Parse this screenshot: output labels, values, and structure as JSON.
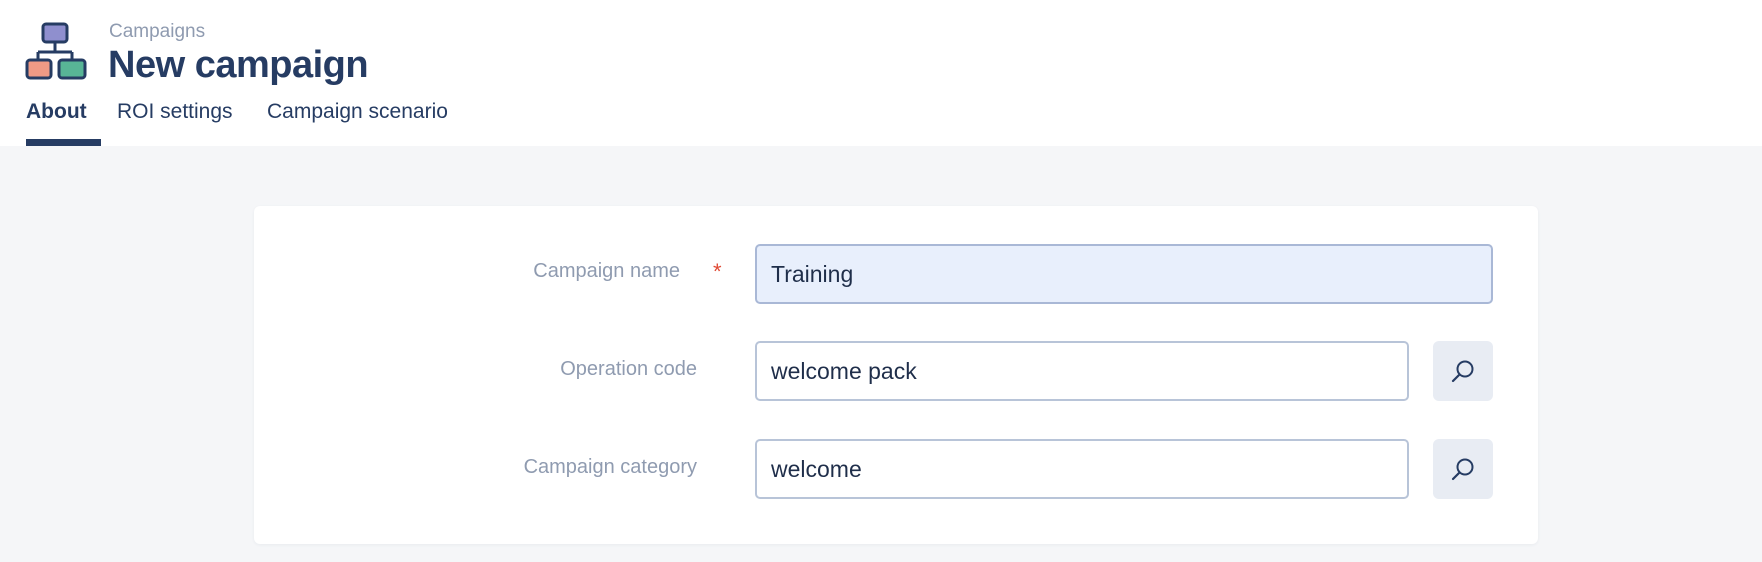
{
  "header": {
    "breadcrumb": "Campaigns",
    "title": "New campaign",
    "icon": "campaign-hierarchy-icon"
  },
  "tabs": [
    {
      "label": "About",
      "active": true
    },
    {
      "label": "ROI settings",
      "active": false
    },
    {
      "label": "Campaign scenario",
      "active": false
    }
  ],
  "form": {
    "campaign_name": {
      "label": "Campaign name",
      "value": "Training",
      "required_mark": "*"
    },
    "operation_code": {
      "label": "Operation code",
      "value": "welcome pack",
      "lookup_icon": "search-icon"
    },
    "campaign_category": {
      "label": "Campaign category",
      "value": "welcome",
      "lookup_icon": "search-icon"
    }
  },
  "colors": {
    "primary": "#263c63",
    "required": "#e04a35",
    "muted_text": "#8f9bb0",
    "focused_field": "#e8effc",
    "page_bg": "#f5f6f8"
  }
}
